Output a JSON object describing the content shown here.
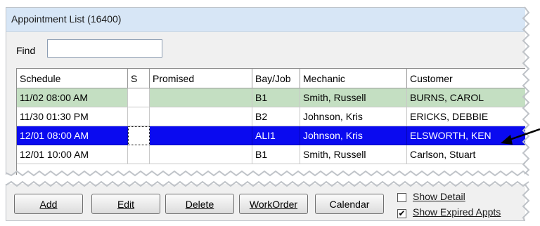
{
  "window": {
    "title": "Appointment List (16400)"
  },
  "find": {
    "label": "Find",
    "value": ""
  },
  "table": {
    "columns": [
      "Schedule",
      "S",
      "Promised",
      "Bay/Job",
      "Mechanic",
      "Customer"
    ],
    "rows": [
      {
        "schedule": "11/02 08:00 AM",
        "s": "",
        "promised": "",
        "bay": "B1",
        "mechanic": "Smith, Russell",
        "customer": "BURNS, CAROL"
      },
      {
        "schedule": "11/30 01:30 PM",
        "s": "",
        "promised": "",
        "bay": "B2",
        "mechanic": "Johnson, Kris",
        "customer": "ERICKS, DEBBIE"
      },
      {
        "schedule": "12/01 08:00 AM",
        "s": "",
        "promised": "",
        "bay": "ALI1",
        "mechanic": "Johnson, Kris",
        "customer": "ELSWORTH, KEN"
      },
      {
        "schedule": "12/01 10:00 AM",
        "s": "",
        "promised": "",
        "bay": "B1",
        "mechanic": "Smith, Russell",
        "customer": "Carlson, Stuart"
      }
    ]
  },
  "buttons": {
    "add": "Add",
    "edit": "Edit",
    "delete": "Delete",
    "workorder": "WorkOrder",
    "calendar": "Calendar"
  },
  "options": {
    "show_detail": {
      "label": "Show Detail",
      "checked": false
    },
    "show_expired": {
      "label": "Show Expired Appts",
      "checked": true
    }
  },
  "colors": {
    "selected_row": "#0a0af0",
    "highlight_row": "#c4dfc2",
    "titlebar": "#d7e6f6"
  },
  "icons": {
    "annotation": "arrow-pointer-icon",
    "check": "checkmark-icon"
  }
}
